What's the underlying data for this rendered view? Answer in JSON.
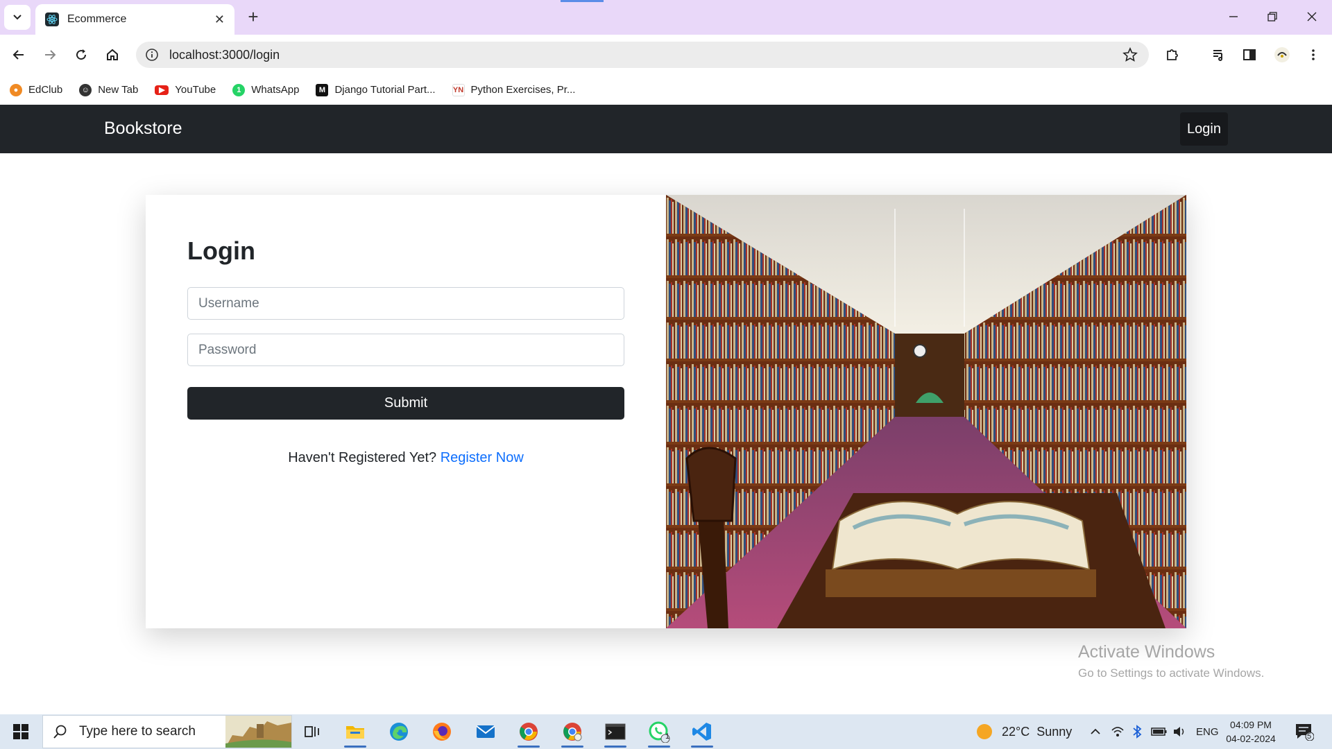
{
  "browser": {
    "tab_title": "Ecommerce",
    "url": "localhost:3000/login",
    "bookmarks": [
      {
        "label": "EdClub",
        "icon": "edclub-icon",
        "color": "#f08a24"
      },
      {
        "label": "New Tab",
        "icon": "newtab-avatar-icon",
        "color": "#333333"
      },
      {
        "label": "YouTube",
        "icon": "youtube-icon",
        "color": "#e62117"
      },
      {
        "label": "WhatsApp",
        "icon": "whatsapp-icon",
        "color": "#25d366"
      },
      {
        "label": "Django Tutorial Part...",
        "icon": "mdn-icon",
        "color": "#111111"
      },
      {
        "label": "Python Exercises, Pr...",
        "icon": "python-exercises-icon",
        "color": "#ffffff"
      }
    ]
  },
  "navbar": {
    "brand": "Bookstore",
    "login_label": "Login"
  },
  "login": {
    "title": "Login",
    "username_placeholder": "Username",
    "password_placeholder": "Password",
    "submit_label": "Submit",
    "register_prompt": "Haven't Registered Yet?",
    "register_link": "Register Now"
  },
  "watermark": {
    "line1": "Activate Windows",
    "line2": "Go to Settings to activate Windows."
  },
  "taskbar": {
    "search_placeholder": "Type here to search",
    "weather": "22°C  Sunny",
    "language": "ENG",
    "time": "04:09 PM",
    "date": "04-02-2024",
    "whatsapp_badge": "1",
    "notification_count": "5"
  },
  "colors": {
    "navbar_bg": "#212529",
    "link": "#0d6efd",
    "tabstrip_bg": "#e9d8f9",
    "taskbar_bg": "#dde7f2"
  }
}
